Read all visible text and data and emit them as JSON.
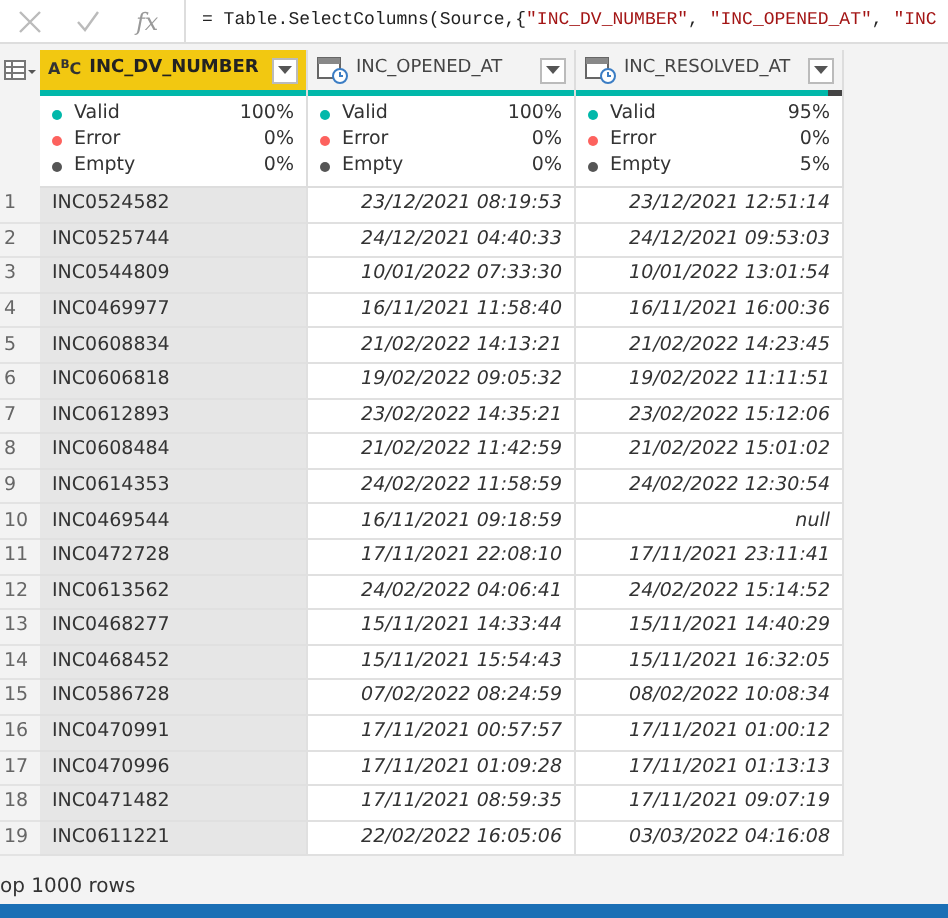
{
  "formula_bar": {
    "fx_label": "fx",
    "parts": [
      {
        "kind": "code",
        "text": "= Table.SelectColumns(Source,{"
      },
      {
        "kind": "string",
        "text": "\"INC_DV_NUMBER\""
      },
      {
        "kind": "code",
        "text": ", "
      },
      {
        "kind": "string",
        "text": "\"INC_OPENED_AT\""
      },
      {
        "kind": "code",
        "text": ", "
      },
      {
        "kind": "string",
        "text": "\"INC"
      }
    ]
  },
  "columns": [
    {
      "name": "INC_DV_NUMBER",
      "kind": "text",
      "type_label": "A$^{B}$C",
      "selected": true,
      "level": 1,
      "quality": [
        {
          "label": "Valid",
          "value": "100%",
          "color": "#01b8aa"
        },
        {
          "label": "Error",
          "value": "0%",
          "color": "#fd625e"
        },
        {
          "label": "Empty",
          "value": "0%",
          "color": "#555555"
        }
      ]
    },
    {
      "name": "INC_OPENED_AT",
      "kind": "datetime",
      "selected": false,
      "level": 1,
      "quality": [
        {
          "label": "Valid",
          "value": "100%",
          "color": "#01b8aa"
        },
        {
          "label": "Error",
          "value": "0%",
          "color": "#fd625e"
        },
        {
          "label": "Empty",
          "value": "0%",
          "color": "#555555"
        }
      ]
    },
    {
      "name": "INC_RESOLVED_AT",
      "kind": "datetime",
      "selected": false,
      "level": 0.95,
      "quality": [
        {
          "label": "Valid",
          "value": "95%",
          "color": "#01b8aa"
        },
        {
          "label": "Error",
          "value": "0%",
          "color": "#fd625e"
        },
        {
          "label": "Empty",
          "value": "5%",
          "color": "#555555"
        }
      ]
    }
  ],
  "rows": [
    {
      "index": "1",
      "cells": [
        {
          "text": "INC0524582"
        },
        {
          "text": "23/12/2021 08:19:53"
        },
        {
          "text": "23/12/2021 12:51:14"
        }
      ]
    },
    {
      "index": "2",
      "cells": [
        {
          "text": "INC0525744"
        },
        {
          "text": "24/12/2021 04:40:33"
        },
        {
          "text": "24/12/2021 09:53:03"
        }
      ]
    },
    {
      "index": "3",
      "cells": [
        {
          "text": "INC0544809"
        },
        {
          "text": "10/01/2022 07:33:30"
        },
        {
          "text": "10/01/2022 13:01:54"
        }
      ]
    },
    {
      "index": "4",
      "cells": [
        {
          "text": "INC0469977"
        },
        {
          "text": "16/11/2021 11:58:40"
        },
        {
          "text": "16/11/2021 16:00:36"
        }
      ]
    },
    {
      "index": "5",
      "cells": [
        {
          "text": "INC0608834"
        },
        {
          "text": "21/02/2022 14:13:21"
        },
        {
          "text": "21/02/2022 14:23:45"
        }
      ]
    },
    {
      "index": "6",
      "cells": [
        {
          "text": "INC0606818"
        },
        {
          "text": "19/02/2022 09:05:32"
        },
        {
          "text": "19/02/2022 11:11:51"
        }
      ]
    },
    {
      "index": "7",
      "cells": [
        {
          "text": "INC0612893"
        },
        {
          "text": "23/02/2022 14:35:21"
        },
        {
          "text": "23/02/2022 15:12:06"
        }
      ]
    },
    {
      "index": "8",
      "cells": [
        {
          "text": "INC0608484"
        },
        {
          "text": "21/02/2022 11:42:59"
        },
        {
          "text": "21/02/2022 15:01:02"
        }
      ]
    },
    {
      "index": "9",
      "cells": [
        {
          "text": "INC0614353"
        },
        {
          "text": "24/02/2022 11:58:59"
        },
        {
          "text": "24/02/2022 12:30:54"
        }
      ]
    },
    {
      "index": "10",
      "cells": [
        {
          "text": "INC0469544"
        },
        {
          "text": "16/11/2021 09:18:59"
        },
        {
          "text": "null"
        }
      ]
    },
    {
      "index": "11",
      "cells": [
        {
          "text": "INC0472728"
        },
        {
          "text": "17/11/2021 22:08:10"
        },
        {
          "text": "17/11/2021 23:11:41"
        }
      ]
    },
    {
      "index": "12",
      "cells": [
        {
          "text": "INC0613562"
        },
        {
          "text": "24/02/2022 04:06:41"
        },
        {
          "text": "24/02/2022 15:14:52"
        }
      ]
    },
    {
      "index": "13",
      "cells": [
        {
          "text": "INC0468277"
        },
        {
          "text": "15/11/2021 14:33:44"
        },
        {
          "text": "15/11/2021 14:40:29"
        }
      ]
    },
    {
      "index": "14",
      "cells": [
        {
          "text": "INC0468452"
        },
        {
          "text": "15/11/2021 15:54:43"
        },
        {
          "text": "15/11/2021 16:32:05"
        }
      ]
    },
    {
      "index": "15",
      "cells": [
        {
          "text": "INC0586728"
        },
        {
          "text": "07/02/2022 08:24:59"
        },
        {
          "text": "08/02/2022 10:08:34"
        }
      ]
    },
    {
      "index": "16",
      "cells": [
        {
          "text": "INC0470991"
        },
        {
          "text": "17/11/2021 00:57:57"
        },
        {
          "text": "17/11/2021 01:00:12"
        }
      ]
    },
    {
      "index": "17",
      "cells": [
        {
          "text": "INC0470996"
        },
        {
          "text": "17/11/2021 01:09:28"
        },
        {
          "text": "17/11/2021 01:13:13"
        }
      ]
    },
    {
      "index": "18",
      "cells": [
        {
          "text": "INC0471482"
        },
        {
          "text": "17/11/2021 08:59:35"
        },
        {
          "text": "17/11/2021 09:07:19"
        }
      ]
    },
    {
      "index": "19",
      "cells": [
        {
          "text": "INC0611221"
        },
        {
          "text": "22/02/2022 16:05:06"
        },
        {
          "text": "03/03/2022 04:16:08"
        }
      ]
    }
  ],
  "status_bar": {
    "text": "op 1000 rows"
  }
}
